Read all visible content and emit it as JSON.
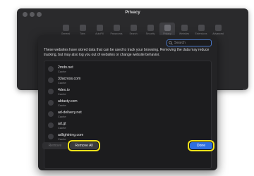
{
  "window": {
    "title": "Privacy",
    "toolbar": [
      {
        "label": "General",
        "icon": "gear-icon"
      },
      {
        "label": "Tabs",
        "icon": "tabs-icon"
      },
      {
        "label": "AutoFill",
        "icon": "pencil-icon"
      },
      {
        "label": "Passwords",
        "icon": "key-icon"
      },
      {
        "label": "Search",
        "icon": "search-icon"
      },
      {
        "label": "Security",
        "icon": "lock-icon"
      },
      {
        "label": "Privacy",
        "icon": "hand-icon",
        "active": true
      },
      {
        "label": "Websites",
        "icon": "globe-icon"
      },
      {
        "label": "Extensions",
        "icon": "puzzle-icon"
      },
      {
        "label": "Advanced",
        "icon": "gear-icon"
      }
    ]
  },
  "sheet": {
    "search": {
      "placeholder": "Search",
      "value": ""
    },
    "description": "These websites have stored data that can be used to track your browsing. Removing the data may reduce tracking, but may also log you out of websites or change website behavior.",
    "sites": [
      {
        "name": "2mdn.net",
        "type": "Cache"
      },
      {
        "name": "33across.com",
        "type": "Cache"
      },
      {
        "name": "4dex.io",
        "type": "Cache"
      },
      {
        "name": "abtasty.com",
        "type": "Cache"
      },
      {
        "name": "ad-delivery.net",
        "type": "Cache"
      },
      {
        "name": "ad.gt",
        "type": "Cache"
      },
      {
        "name": "adlightning.com",
        "type": "Cache"
      }
    ],
    "buttons": {
      "remove": "Remove",
      "remove_all": "Remove All",
      "done": "Done"
    }
  },
  "colors": {
    "accent": "#2f6fe0",
    "highlight": "#f2e21a"
  }
}
